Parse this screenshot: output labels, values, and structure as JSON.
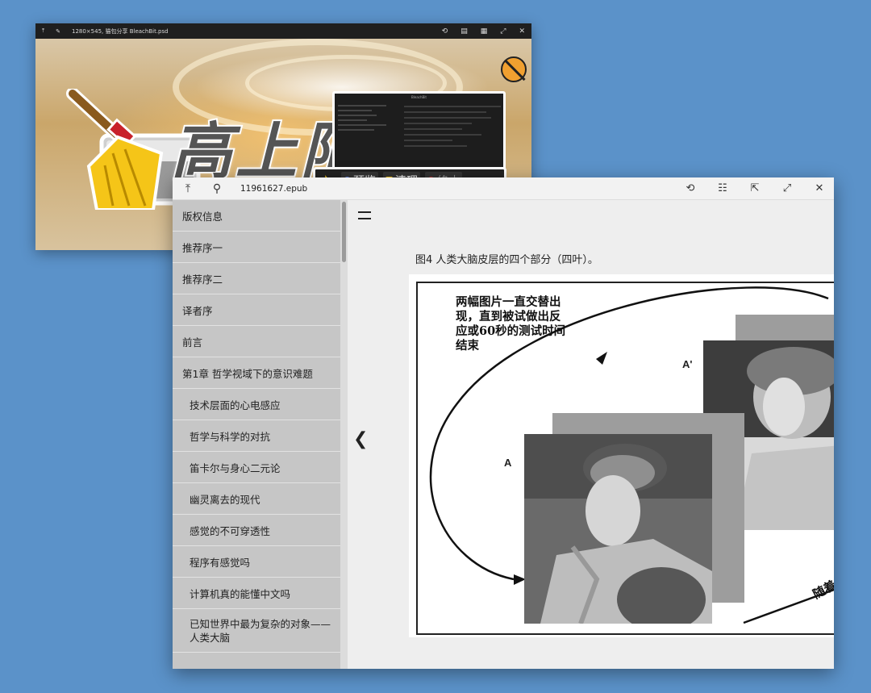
{
  "back_window": {
    "title": "1280×545, 猫包分享 BleachBit.psd",
    "banner_text": "高上限",
    "toolbar": {
      "preview_label": "预览",
      "clean_label": "清理",
      "stop_label": "终止"
    },
    "mini_window_title": "BleachBit"
  },
  "front_window": {
    "file_name": "11961627.epub",
    "toc": [
      {
        "label": "版权信息",
        "level": 1
      },
      {
        "label": "推荐序一",
        "level": 1
      },
      {
        "label": "推荐序二",
        "level": 1
      },
      {
        "label": "译者序",
        "level": 1
      },
      {
        "label": "前言",
        "level": 1
      },
      {
        "label": "第1章 哲学视域下的意识难题",
        "level": 1
      },
      {
        "label": "技术层面的心电感应",
        "level": 2
      },
      {
        "label": "哲学与科学的对抗",
        "level": 2
      },
      {
        "label": "笛卡尔与身心二元论",
        "level": 2
      },
      {
        "label": "幽灵离去的现代",
        "level": 2
      },
      {
        "label": "感觉的不可穿透性",
        "level": 2
      },
      {
        "label": "程序有感觉吗",
        "level": 2
      },
      {
        "label": "计算机真的能懂中文吗",
        "level": 2
      },
      {
        "label": "已知世界中最为复杂的对象——人类大脑",
        "level": 2
      }
    ],
    "content": {
      "caption": "图4 人类大脑皮层的四个部分（四叶）。",
      "figure_text": "两幅图片一直交替出\n现，直到被试做出反\n应或60秒的测试时间\n结束",
      "label_a": "A",
      "label_a_prime": "A'",
      "side_text": "随着"
    }
  }
}
